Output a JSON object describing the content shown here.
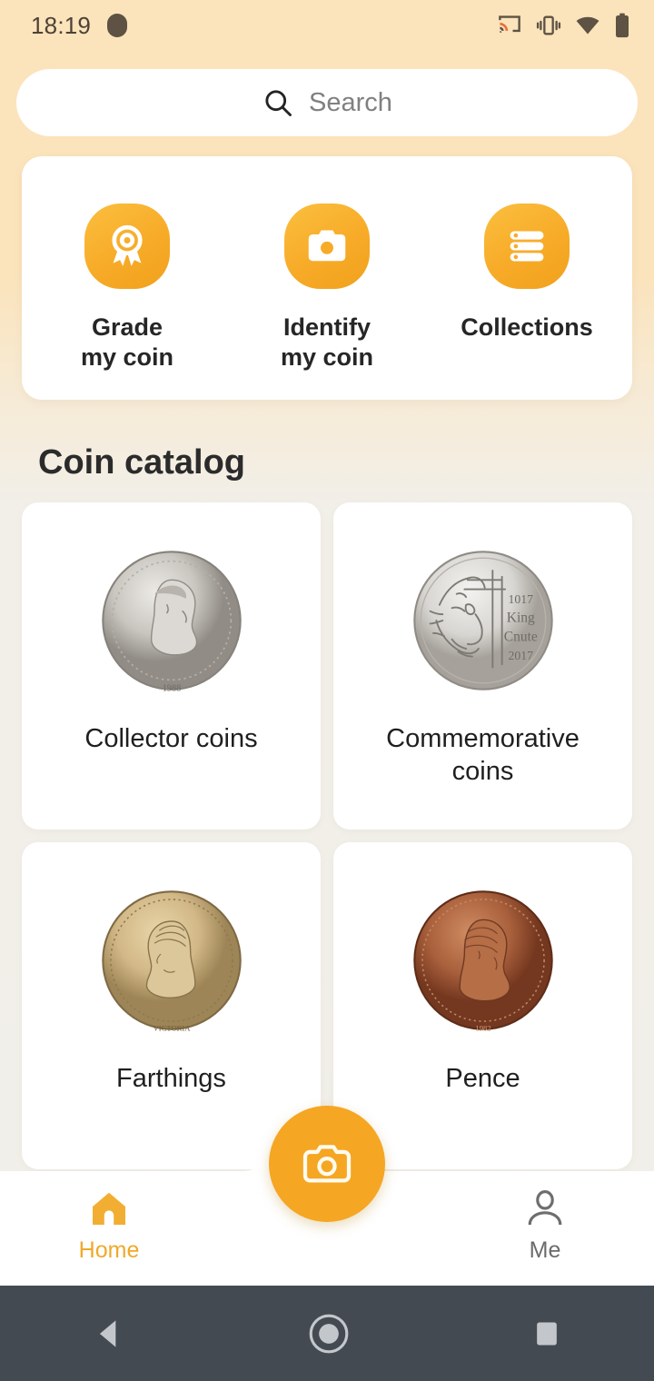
{
  "status_bar": {
    "time": "18:19",
    "icons": [
      "notification-dot",
      "cast-icon",
      "vibrate-icon",
      "wifi-icon",
      "battery-icon"
    ]
  },
  "search": {
    "placeholder": "Search",
    "icon": "search-icon"
  },
  "quick_actions": {
    "items": [
      {
        "label": "Grade\nmy coin",
        "icon": "award-medal-icon"
      },
      {
        "label": "Identify\nmy coin",
        "icon": "camera-icon"
      },
      {
        "label": "Collections",
        "icon": "list-stack-icon"
      }
    ]
  },
  "catalog": {
    "title": "Coin catalog",
    "cards": [
      {
        "label": "Collector coins",
        "coin": "silver-elizabeth-ii-1988"
      },
      {
        "label": "Commemorative\ncoins",
        "coin": "silver-king-canute-2017"
      },
      {
        "label": "Farthings",
        "coin": "gold-victoria-farthing"
      },
      {
        "label": "Pence",
        "coin": "copper-elizabeth-ii-1982"
      }
    ]
  },
  "bottom_nav": {
    "home_label": "Home",
    "me_label": "Me",
    "fab_icon": "camera-icon",
    "active": "Home"
  },
  "android_nav": {
    "back": "back-triangle",
    "home": "home-circle",
    "recents": "recents-square"
  },
  "colors": {
    "accent": "#f5a623",
    "tile_gradient_start": "#fbbf3f",
    "tile_gradient_end": "#f1a11c",
    "top_background": "#fbe3bb",
    "page_background": "#f2efe9",
    "android_nav_background": "#434a52"
  }
}
